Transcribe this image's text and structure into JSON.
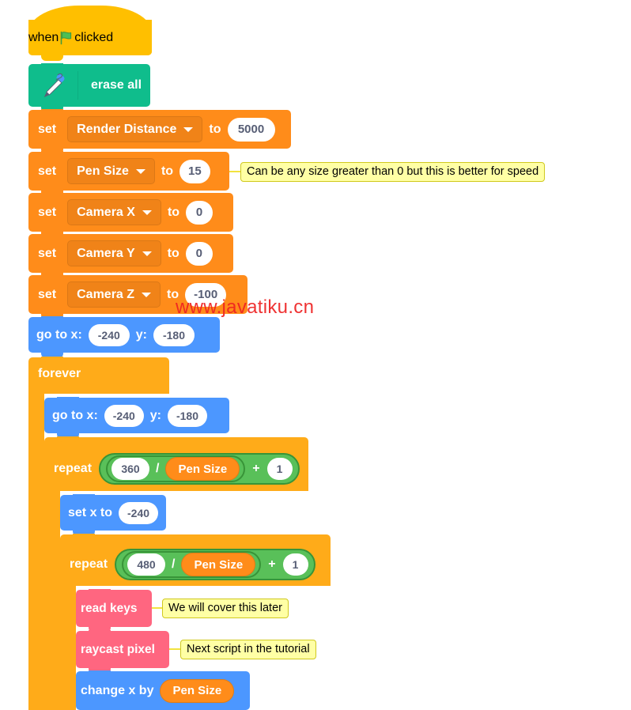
{
  "app": {
    "kind": "scratch-block-editor",
    "watermark": "www.javatiku.cn"
  },
  "palette": {
    "event_yellow": "#ffbf00",
    "pen_green": "#0fbd8c",
    "variables_orange": "#ff8c1a",
    "motion_blue": "#4c97ff",
    "control_orange": "#ffab19",
    "operators_green": "#59c059",
    "custom_pink": "#ff6680",
    "comment_yellow": "#ffffa5",
    "input_white": "#ffffff",
    "input_text": "#575e75"
  },
  "script": {
    "hat": {
      "word_when": "when",
      "icon": "green-flag-icon",
      "word_clicked": "clicked"
    },
    "erase_all": {
      "icon": "pen-icon",
      "label": "erase all"
    },
    "set_blocks": [
      {
        "keyword": "set",
        "variable": "Render Distance",
        "to": "to",
        "value": "5000"
      },
      {
        "keyword": "set",
        "variable": "Pen Size",
        "to": "to",
        "value": "15"
      },
      {
        "keyword": "set",
        "variable": "Camera X",
        "to": "to",
        "value": "0"
      },
      {
        "keyword": "set",
        "variable": "Camera Y",
        "to": "to",
        "value": "0"
      },
      {
        "keyword": "set",
        "variable": "Camera Z",
        "to": "to",
        "value": "-100"
      }
    ],
    "goto_outer": {
      "label_x": "go to x:",
      "x": "-240",
      "label_y": "y:",
      "y": "-180"
    },
    "forever": {
      "label": "forever"
    },
    "goto_inner": {
      "label_x": "go to x:",
      "x": "-240",
      "label_y": "y:",
      "y": "-180"
    },
    "repeat_360": {
      "label": "repeat",
      "numerator": "360",
      "divide_symbol": "/",
      "denominator": "Pen Size",
      "plus_symbol": "+",
      "addend": "1"
    },
    "set_x_to": {
      "label": "set x to",
      "value": "-240"
    },
    "repeat_480": {
      "label": "repeat",
      "numerator": "480",
      "divide_symbol": "/",
      "denominator": "Pen Size",
      "plus_symbol": "+",
      "addend": "1"
    },
    "read_keys": {
      "label": "read keys"
    },
    "raycast_pixel": {
      "label": "raycast pixel"
    },
    "change_x_by": {
      "label": "change x by",
      "value": "Pen Size"
    }
  },
  "comments": [
    {
      "id": "pen-size-comment",
      "text": "Can be any size greater than 0 but this is better for speed"
    },
    {
      "id": "read-keys-comment",
      "text": "We will cover this later"
    },
    {
      "id": "raycast-pixel-comment",
      "text": "Next script in the tutorial"
    }
  ]
}
